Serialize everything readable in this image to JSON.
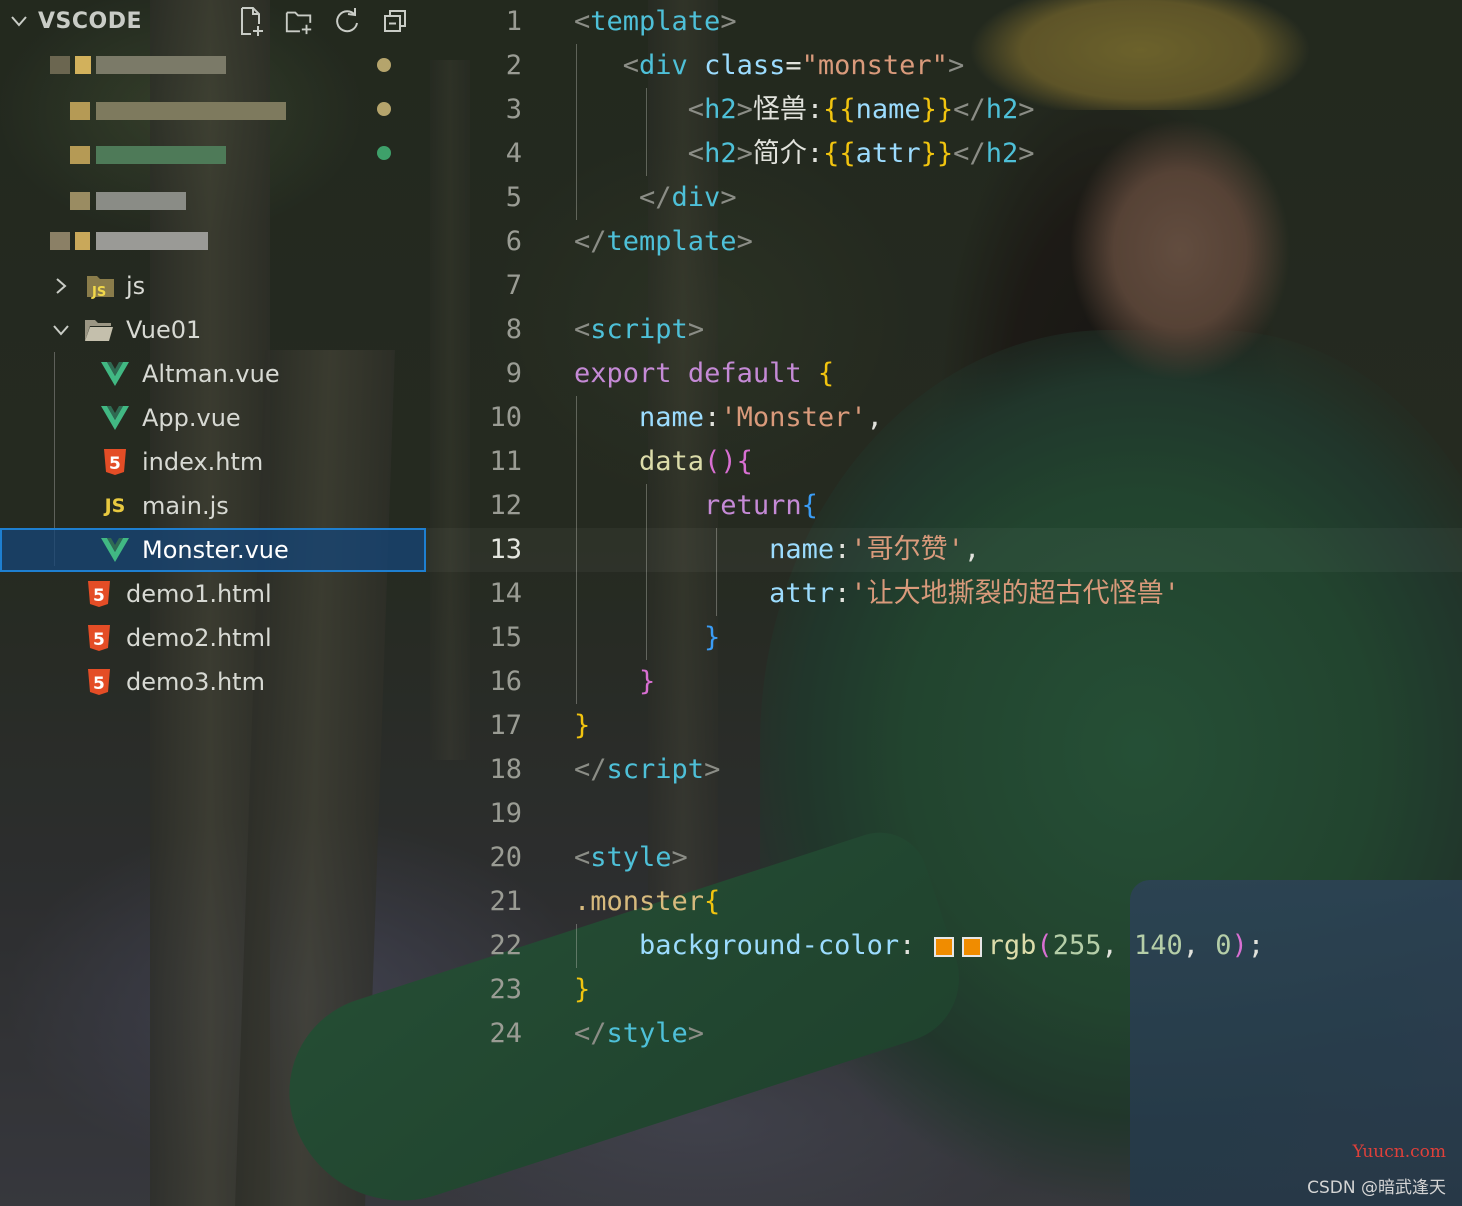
{
  "explorer": {
    "title": "VSCODE",
    "actions": [
      "new-file-icon",
      "new-folder-icon",
      "refresh-icon",
      "collapse-all-icon"
    ],
    "blurred_item_count": 5,
    "status_dots": [
      "#b5a46c",
      "#b5a46c",
      "#3ea06a"
    ],
    "items": [
      {
        "label": "js",
        "type": "folder-js",
        "expanded": false
      },
      {
        "label": "Vue01",
        "type": "folder",
        "expanded": true
      },
      {
        "label": "Altman.vue",
        "type": "vue"
      },
      {
        "label": "App.vue",
        "type": "vue"
      },
      {
        "label": "index.htm",
        "type": "html"
      },
      {
        "label": "main.js",
        "type": "js"
      },
      {
        "label": "Monster.vue",
        "type": "vue",
        "selected": true
      },
      {
        "label": "demo1.html",
        "type": "html"
      },
      {
        "label": "demo2.html",
        "type": "html"
      },
      {
        "label": "demo3.htm",
        "type": "html"
      }
    ]
  },
  "editor": {
    "current_line": 13,
    "lines": [
      {
        "n": "1",
        "t": [
          [
            "punc",
            "<"
          ],
          [
            "tag",
            "template"
          ],
          [
            "punc",
            ">"
          ]
        ]
      },
      {
        "n": "2",
        "t": [
          [
            "text",
            "   "
          ],
          [
            "punc",
            "<"
          ],
          [
            "tag",
            "div"
          ],
          [
            "text",
            " "
          ],
          [
            "attr",
            "class"
          ],
          [
            "text",
            "="
          ],
          [
            "str",
            "\"monster\""
          ],
          [
            "punc",
            ">"
          ]
        ]
      },
      {
        "n": "3",
        "t": [
          [
            "text",
            "       "
          ],
          [
            "punc",
            "<"
          ],
          [
            "tag",
            "h2"
          ],
          [
            "punc",
            ">"
          ],
          [
            "text",
            "怪兽:"
          ],
          [
            "brace1",
            "{{"
          ],
          [
            "attr",
            "name"
          ],
          [
            "brace1",
            "}}"
          ],
          [
            "punc",
            "</"
          ],
          [
            "tag",
            "h2"
          ],
          [
            "punc",
            ">"
          ]
        ]
      },
      {
        "n": "4",
        "t": [
          [
            "text",
            "       "
          ],
          [
            "punc",
            "<"
          ],
          [
            "tag",
            "h2"
          ],
          [
            "punc",
            ">"
          ],
          [
            "text",
            "简介:"
          ],
          [
            "brace1",
            "{{"
          ],
          [
            "attr",
            "attr"
          ],
          [
            "brace1",
            "}}"
          ],
          [
            "punc",
            "</"
          ],
          [
            "tag",
            "h2"
          ],
          [
            "punc",
            ">"
          ]
        ]
      },
      {
        "n": "5",
        "t": [
          [
            "text",
            "    "
          ],
          [
            "punc",
            "</"
          ],
          [
            "tag",
            "div"
          ],
          [
            "punc",
            ">"
          ]
        ]
      },
      {
        "n": "6",
        "t": [
          [
            "punc",
            "</"
          ],
          [
            "tag",
            "template"
          ],
          [
            "punc",
            ">"
          ]
        ]
      },
      {
        "n": "7",
        "t": []
      },
      {
        "n": "8",
        "t": [
          [
            "punc",
            "<"
          ],
          [
            "tag",
            "script"
          ],
          [
            "punc",
            ">"
          ]
        ]
      },
      {
        "n": "9",
        "t": [
          [
            "kw",
            "export"
          ],
          [
            "text",
            " "
          ],
          [
            "kw",
            "default"
          ],
          [
            "text",
            " "
          ],
          [
            "brace1",
            "{"
          ]
        ]
      },
      {
        "n": "10",
        "t": [
          [
            "text",
            "    "
          ],
          [
            "prop",
            "name"
          ],
          [
            "text",
            ":"
          ],
          [
            "str",
            "'Monster'"
          ],
          [
            "text",
            ","
          ]
        ]
      },
      {
        "n": "11",
        "t": [
          [
            "text",
            "    "
          ],
          [
            "fn",
            "data"
          ],
          [
            "brace2",
            "()"
          ],
          [
            "brace2",
            "{"
          ]
        ]
      },
      {
        "n": "12",
        "t": [
          [
            "text",
            "        "
          ],
          [
            "kw",
            "return"
          ],
          [
            "brace3",
            "{"
          ]
        ]
      },
      {
        "n": "13",
        "t": [
          [
            "text",
            "            "
          ],
          [
            "prop",
            "name"
          ],
          [
            "text",
            ":"
          ],
          [
            "str",
            "'哥尔赞'"
          ],
          [
            "text",
            ","
          ]
        ]
      },
      {
        "n": "14",
        "t": [
          [
            "text",
            "            "
          ],
          [
            "prop",
            "attr"
          ],
          [
            "text",
            ":"
          ],
          [
            "str",
            "'让大地撕裂的超古代怪兽'"
          ]
        ]
      },
      {
        "n": "15",
        "t": [
          [
            "text",
            "        "
          ],
          [
            "brace3",
            "}"
          ]
        ]
      },
      {
        "n": "16",
        "t": [
          [
            "text",
            "    "
          ],
          [
            "brace2",
            "}"
          ]
        ]
      },
      {
        "n": "17",
        "t": [
          [
            "brace1",
            "}"
          ]
        ]
      },
      {
        "n": "18",
        "t": [
          [
            "punc",
            "</"
          ],
          [
            "tag",
            "script"
          ],
          [
            "punc",
            ">"
          ]
        ]
      },
      {
        "n": "19",
        "t": []
      },
      {
        "n": "20",
        "t": [
          [
            "punc",
            "<"
          ],
          [
            "tag",
            "style"
          ],
          [
            "punc",
            ">"
          ]
        ]
      },
      {
        "n": "21",
        "t": [
          [
            "cls",
            ".monster"
          ],
          [
            "brace1",
            "{"
          ]
        ]
      },
      {
        "n": "22",
        "t": [
          [
            "text",
            "    "
          ],
          [
            "prop",
            "background-color"
          ],
          [
            "text",
            ": "
          ],
          [
            "swatch",
            "#f08c00"
          ],
          [
            "swatch",
            "#f08c00"
          ],
          [
            "fn",
            "rgb"
          ],
          [
            "brace2",
            "("
          ],
          [
            "num",
            "255"
          ],
          [
            "text",
            ", "
          ],
          [
            "num",
            "140"
          ],
          [
            "text",
            ", "
          ],
          [
            "num",
            "0"
          ],
          [
            "brace2",
            ")"
          ],
          [
            "text",
            ";"
          ]
        ]
      },
      {
        "n": "23",
        "t": [
          [
            "brace1",
            "}"
          ]
        ]
      },
      {
        "n": "24",
        "t": [
          [
            "punc",
            "</"
          ],
          [
            "tag",
            "style"
          ],
          [
            "punc",
            ">"
          ]
        ]
      }
    ]
  },
  "watermark": {
    "site": "Yuucn.com",
    "author": "CSDN @暗武逢天"
  }
}
